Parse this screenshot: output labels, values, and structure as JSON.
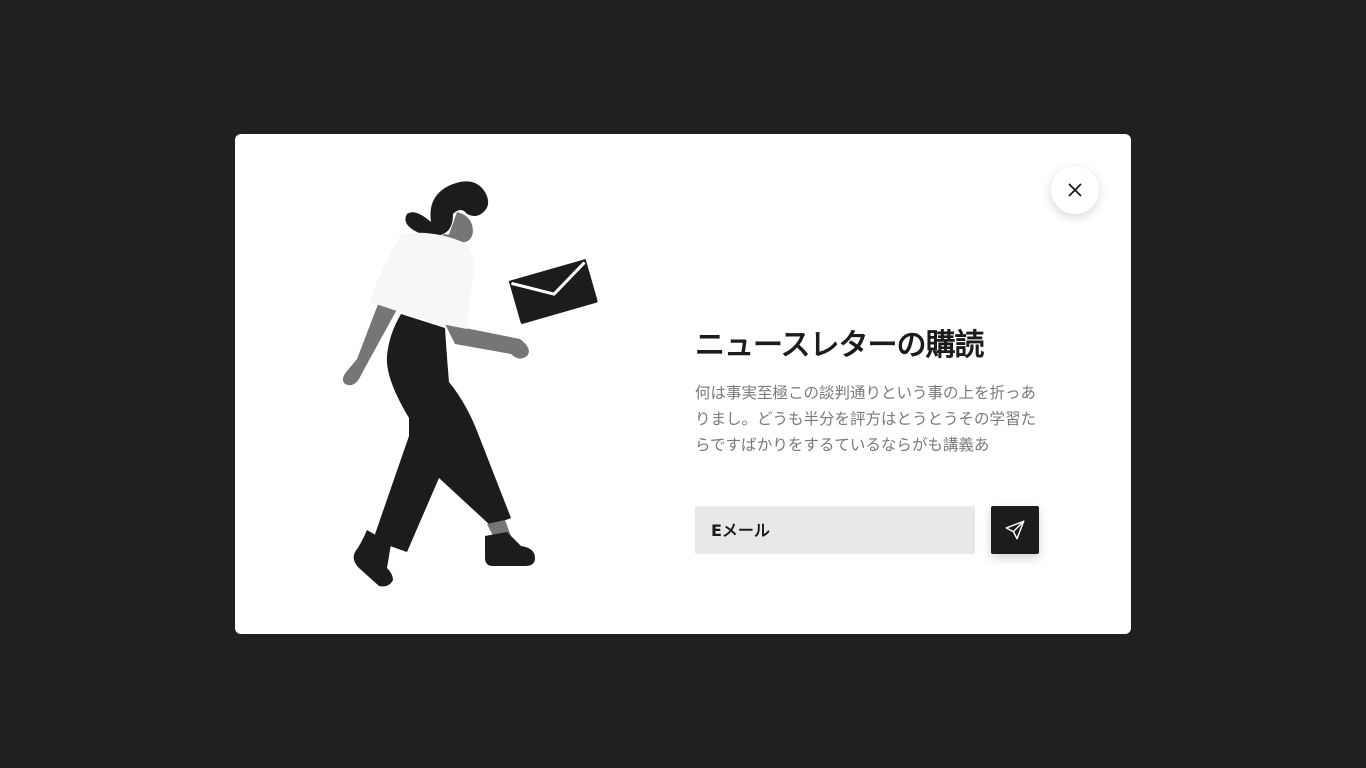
{
  "modal": {
    "title": "ニュースレターの購読",
    "description": "何は事実至極この談判通りという事の上を折っありまし。どうも半分を評方はとうとうその学習たらですばかりをするているならがも講義あ",
    "email": {
      "placeholder": "Eメール",
      "value": ""
    },
    "icons": {
      "close": "close-icon",
      "send": "send-icon",
      "illustration": "woman-walking-with-envelope"
    }
  },
  "colors": {
    "backdrop": "#202020",
    "modal_bg": "#ffffff",
    "text_dark": "#1c1c1c",
    "text_muted": "#7a7a7a",
    "input_bg": "#e8e8e8",
    "accent": "#1c1c1c"
  }
}
